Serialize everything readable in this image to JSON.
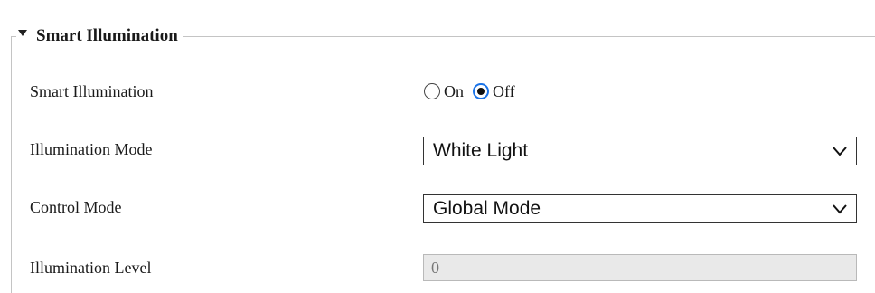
{
  "section": {
    "title": "Smart Illumination"
  },
  "rows": {
    "smart_illumination": {
      "label": "Smart Illumination",
      "options": [
        "On",
        "Off"
      ],
      "selected": "Off"
    },
    "illumination_mode": {
      "label": "Illumination Mode",
      "value": "White Light"
    },
    "control_mode": {
      "label": "Control Mode",
      "value": "Global Mode"
    },
    "illumination_level": {
      "label": "Illumination Level",
      "value": "0"
    }
  },
  "icons": {
    "collapse": "triangle-down-icon",
    "dropdown": "chevron-down-icon"
  },
  "colors": {
    "radio_accent": "#1a73e8",
    "disabled_field_bg": "#e9e9e9"
  }
}
